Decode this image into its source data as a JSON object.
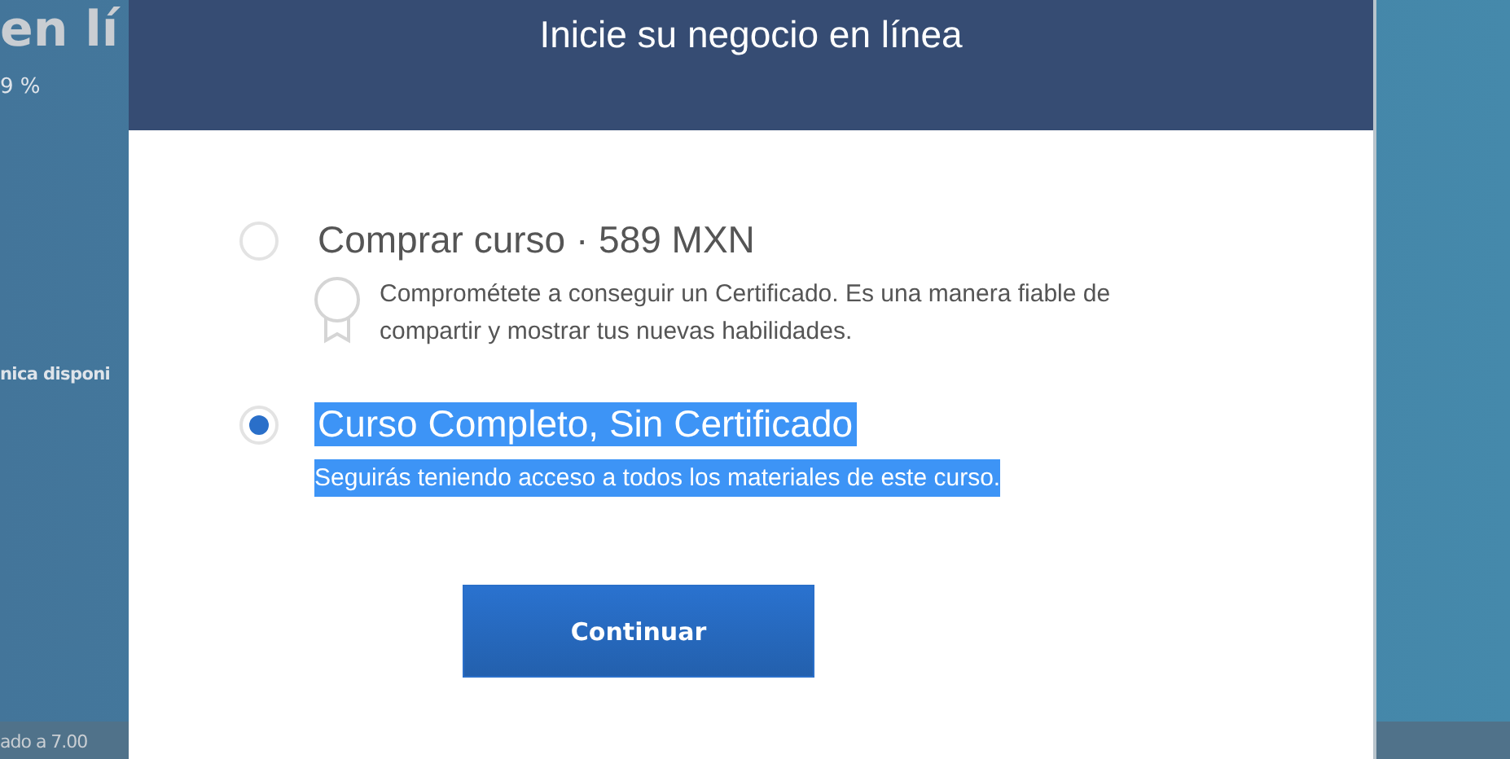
{
  "background": {
    "heading": "en lí",
    "rating": "9 %",
    "note": "nica disponi",
    "footer": "ado a 7.00"
  },
  "dialog": {
    "title": "Inicie su negocio en línea",
    "options": [
      {
        "title": "Comprar curso · 589 MXN",
        "description": "Comprométete a conseguir un Certificado. Es una manera fiable de compartir y mostrar tus nuevas habilidades.",
        "selected": false,
        "highlighted": false,
        "kind": "certificate"
      },
      {
        "title": "Curso Completo, Sin Certificado",
        "description": "Seguirás teniendo acceso a todos los materiales de este curso.",
        "selected": true,
        "highlighted": true,
        "kind": "plain"
      }
    ],
    "button": "Continuar"
  }
}
